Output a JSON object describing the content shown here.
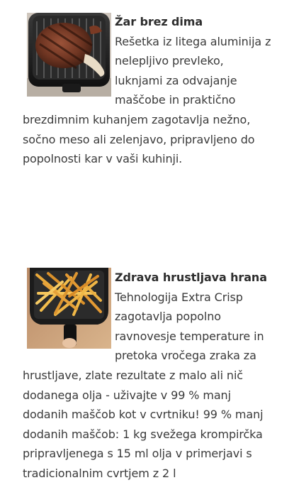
{
  "features": [
    {
      "title": "Žar brez dima",
      "body": "Rešetka iz litega aluminija z nelepljivo prevleko, luknjami za odvajanje maščobe in praktično brezdimnim kuhanjem zagotavlja nežno, sočno meso ali zelenjavo, pripravljeno do popolnosti kar v vaši kuhinji.",
      "image_icon": "grilled-steak-in-airfryer-basket-image"
    },
    {
      "title": "Zdrava hrustljava hrana",
      "body": "Tehnologija Extra Crisp zagotavlja popolno ravnovesje temperature in pretoka vročega zraka za hrustljave, zlate rezultate z malo ali nič dodanega olja - uživajte v 99 % manj dodanih maščob kot v cvrtniku! 99 % manj dodanih maščob: 1 kg svežega krompirčka pripravljenega s 15 ml olja v primerjavi s tradicionalnim cvrtjem z 2 l",
      "image_icon": "french-fries-in-airfryer-basket-image"
    }
  ]
}
